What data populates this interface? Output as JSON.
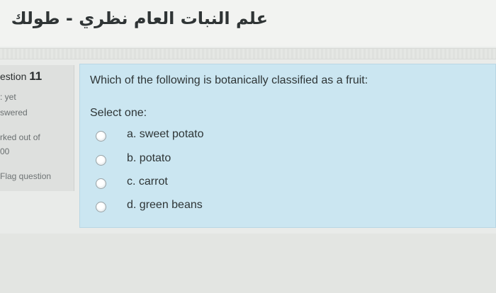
{
  "header": {
    "course_title": "علم النبات العام نظري - طولك"
  },
  "info": {
    "question_prefix": "estion",
    "question_number": "11",
    "status_line1": ": yet",
    "status_line2": "swered",
    "marks_line1": "rked out of",
    "marks_line2": "00",
    "flag_label": "Flag question"
  },
  "question": {
    "text": "Which of the following is botanically classified as a fruit:",
    "select_prompt": "Select one:",
    "options": [
      {
        "label": "a. sweet potato"
      },
      {
        "label": "b. potato"
      },
      {
        "label": "c. carrot"
      },
      {
        "label": "d. green beans"
      }
    ]
  }
}
